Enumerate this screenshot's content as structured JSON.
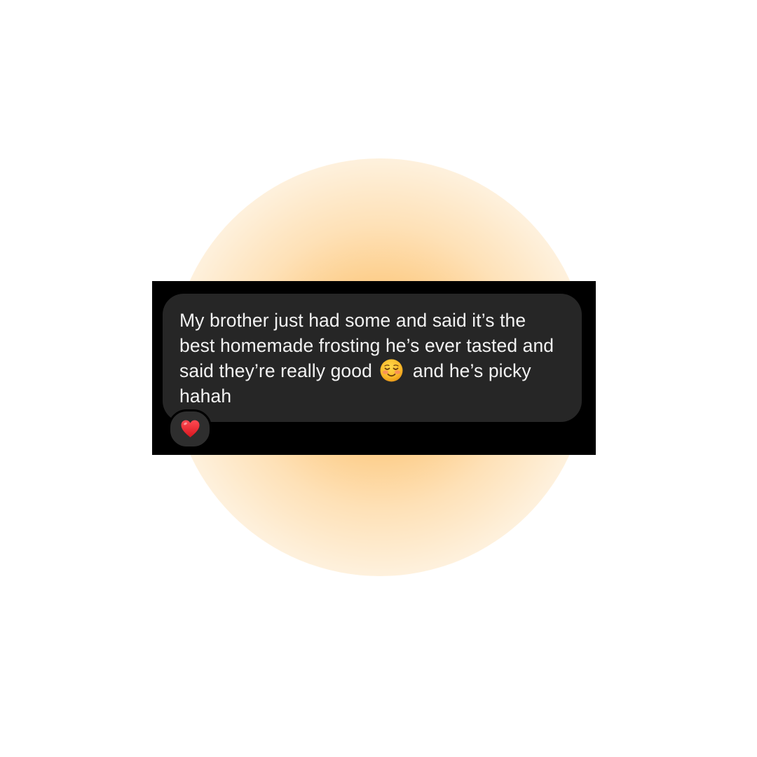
{
  "message": {
    "text_part1": "My brother just had some and said it’s the best homemade frosting he’s ever tasted and said they’re really good",
    "text_part2": "and he’s picky hahah",
    "inline_emoji": "smiling-face-emoji"
  },
  "reaction": {
    "icon": "heart-icon",
    "color": "#e3262f"
  },
  "colors": {
    "bubble_background": "#262626",
    "screenshot_background": "#000000",
    "text": "#f2f2f2",
    "glow": "#fcb246"
  }
}
